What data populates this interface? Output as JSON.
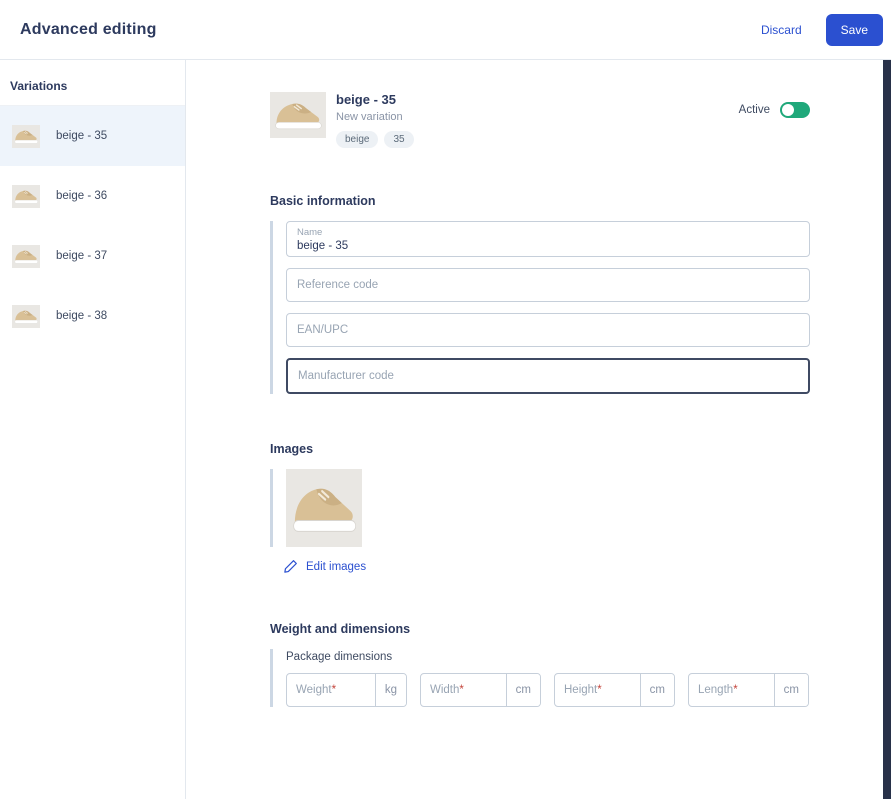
{
  "colors": {
    "primary": "#2b50d0",
    "toggle-on": "#1fa87a",
    "accent-bar": "#ccd7e4"
  },
  "header": {
    "title": "Advanced editing",
    "discard_label": "Discard",
    "save_label": "Save"
  },
  "sidebar": {
    "title": "Variations",
    "selected_index": 0,
    "items": [
      {
        "label": "beige - 35"
      },
      {
        "label": "beige - 36"
      },
      {
        "label": "beige - 37"
      },
      {
        "label": "beige - 38"
      }
    ]
  },
  "variation": {
    "title": "beige - 35",
    "subtitle": "New variation",
    "chips": [
      "beige",
      "35"
    ],
    "active_label": "Active",
    "active": true
  },
  "basic": {
    "title": "Basic information",
    "name_label": "Name",
    "name_value": "beige - 35",
    "reference_placeholder": "Reference code",
    "ean_placeholder": "EAN/UPC",
    "manufacturer_placeholder": "Manufacturer code"
  },
  "images": {
    "title": "Images",
    "edit_label": "Edit images"
  },
  "dimensions": {
    "title": "Weight and dimensions",
    "group_label": "Package dimensions",
    "fields": [
      {
        "label": "Weight",
        "required_mark": "*",
        "unit": "kg"
      },
      {
        "label": "Width",
        "required_mark": "*",
        "unit": "cm"
      },
      {
        "label": "Height",
        "required_mark": "*",
        "unit": "cm"
      },
      {
        "label": "Length",
        "required_mark": "*",
        "unit": "cm"
      }
    ]
  },
  "icons": {
    "edit": "pencil-icon",
    "active": "toggle-switch"
  }
}
